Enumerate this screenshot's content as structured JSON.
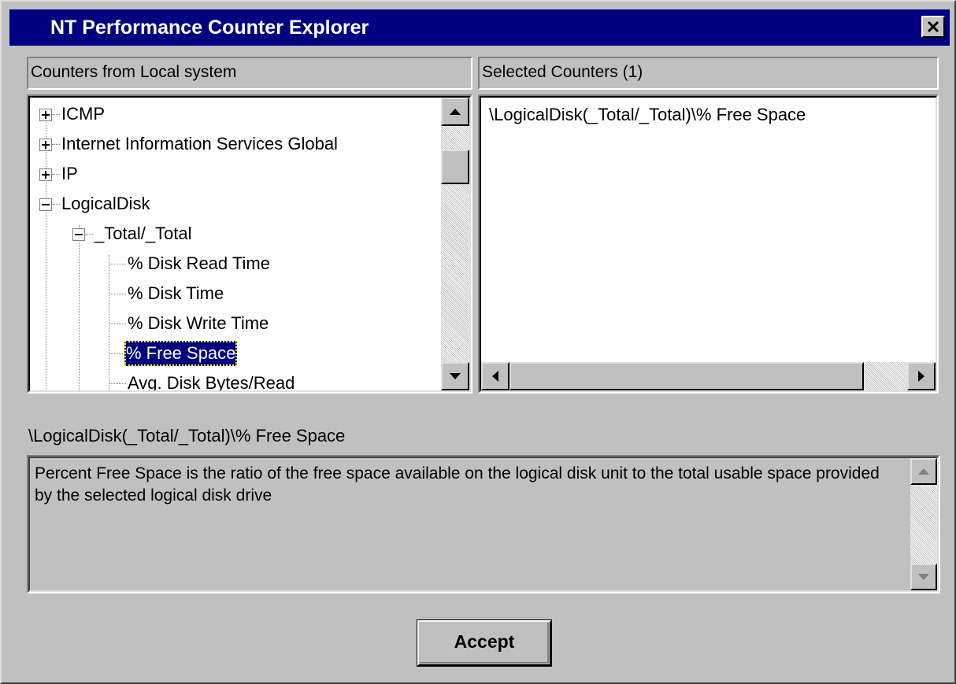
{
  "window": {
    "title": "NT Performance Counter Explorer",
    "close_icon": "close-x-icon"
  },
  "left_panel": {
    "header": "Counters from Local system",
    "tree": [
      {
        "label": "ICMP",
        "expander": "plus"
      },
      {
        "label": "Internet Information Services Global",
        "expander": "plus"
      },
      {
        "label": "IP",
        "expander": "plus"
      },
      {
        "label": "LogicalDisk",
        "expander": "minus"
      },
      {
        "label": "_Total/_Total",
        "expander": "minus"
      },
      {
        "label": "% Disk Read Time"
      },
      {
        "label": "% Disk Time"
      },
      {
        "label": "% Disk Write Time"
      },
      {
        "label": "% Free Space",
        "selected": true
      },
      {
        "label": "Avg. Disk Bytes/Read"
      }
    ]
  },
  "right_panel": {
    "header": "Selected Counters (1)",
    "items": [
      "\\LogicalDisk(_Total/_Total)\\% Free Space"
    ]
  },
  "description": {
    "path": "\\LogicalDisk(_Total/_Total)\\% Free Space",
    "text": "Percent Free Space is the ratio of the free space available on the logical disk unit to the total usable space provided by the selected logical disk drive"
  },
  "buttons": {
    "accept": "Accept"
  },
  "colors": {
    "titlebar": "#000080",
    "face": "#c0c0c0",
    "selection": "#000080"
  }
}
